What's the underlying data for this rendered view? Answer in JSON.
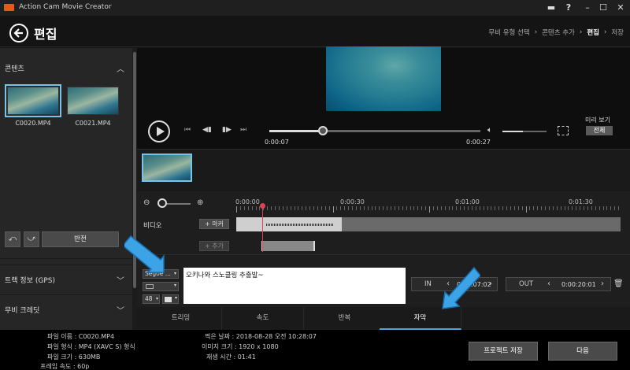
{
  "app": {
    "title": "Action Cam Movie Creator"
  },
  "header": {
    "page_title": "편집",
    "breadcrumb": [
      "무비 유형 선택",
      "콘텐츠 추가",
      "편집",
      "저장"
    ]
  },
  "contents": {
    "title": "콘텐츠",
    "files": [
      {
        "name": "C0020.MP4",
        "selected": true
      },
      {
        "name": "C0021.MP4",
        "selected": false
      }
    ],
    "flip_label": "반전"
  },
  "left_sections": [
    {
      "label": "트랙 정보 (GPS)"
    },
    {
      "label": "무비 크레딧"
    }
  ],
  "player": {
    "current_time": "0:00:07",
    "total_time": "0:00:27",
    "preview_label": "미리 보기",
    "preview_mode": "전체"
  },
  "timeline": {
    "ruler_labels": [
      "0:00:00",
      "0:00:30",
      "0:01:00",
      "0:01:30"
    ],
    "video_track_label": "비디오",
    "marker_button": "+ 마커",
    "add_button": "+ 추가"
  },
  "subtitle": {
    "font": "Segoe ...",
    "size": "48",
    "text": "오키나와 스노클링 추출발~",
    "in_label": "IN",
    "in_time": "0:00:07:02",
    "out_label": "OUT",
    "out_time": "0:00:20:01"
  },
  "tabs": [
    {
      "label": "트리밍",
      "active": false
    },
    {
      "label": "속도",
      "active": false
    },
    {
      "label": "반복",
      "active": false
    },
    {
      "label": "자막",
      "active": true
    }
  ],
  "file_info": {
    "filename": "파일 이름 : C0020.MP4",
    "format": "파일 형식 : MP4 (XAVC S) 형식",
    "size": "파일 크기 : 630MB",
    "framerate": "프레임 속도 : 60p",
    "shot_date": "찍은 날짜 : 2018-08-28 오전 10:28:07",
    "image_size": "이미지 크기 : 1920 x 1080",
    "duration": "재생 시간 : 01:41"
  },
  "actions": {
    "save_project": "프로젝트 저장",
    "next": "다음"
  },
  "colors": {
    "accent": "#4aa8e0",
    "app_logo": "#e8581c",
    "playhead": "#e04050",
    "annotation_arrow": "#3ba3e6"
  }
}
